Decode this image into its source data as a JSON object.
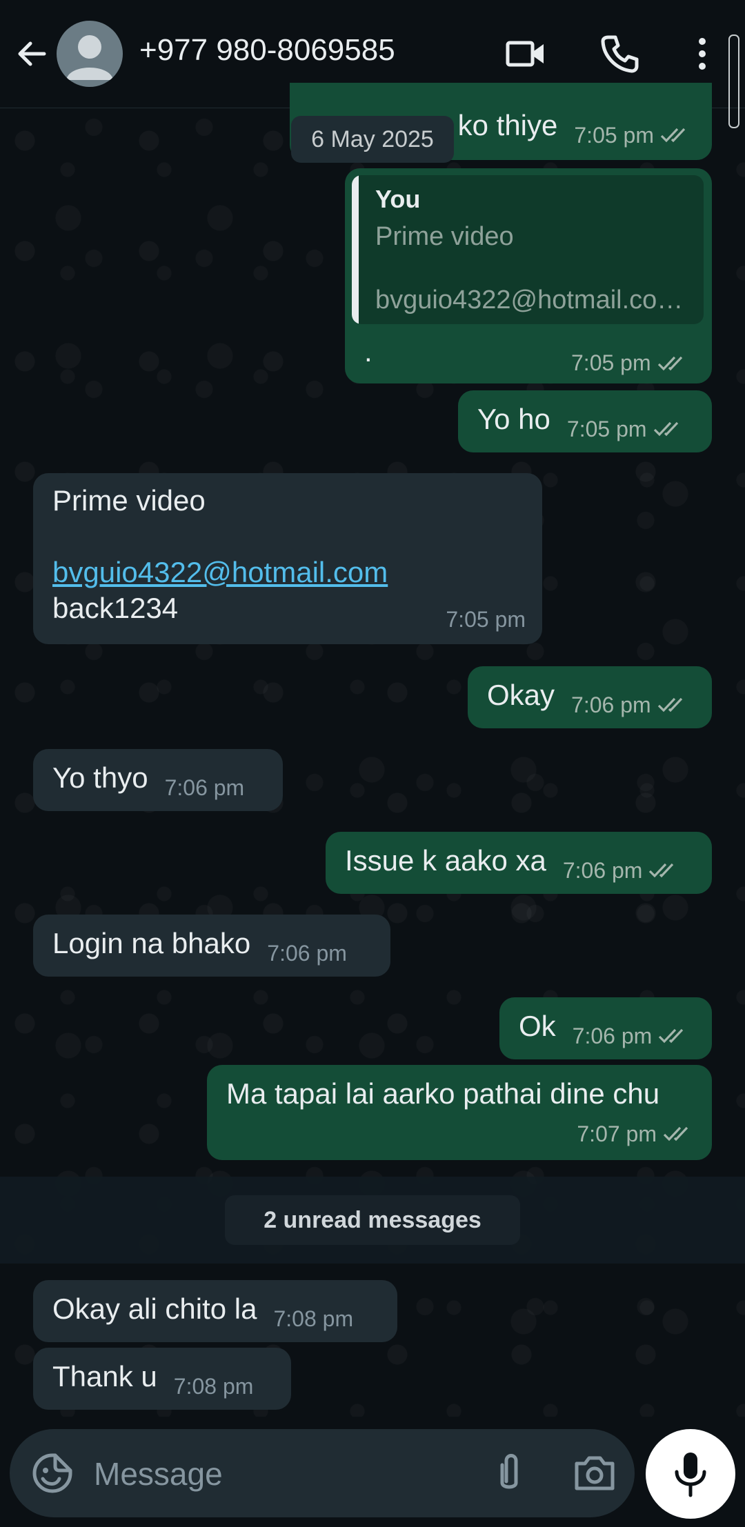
{
  "header": {
    "contact": "+977 980-8069585"
  },
  "date_chip": "6 May 2025",
  "messages": {
    "m0": {
      "text": "ko thiye",
      "time": "7:05 pm"
    },
    "m1": {
      "quote_author": "You",
      "quote_title": "Prime video",
      "quote_email": "bvguio4322@hotmail.co…",
      "text": ".",
      "time": "7:05 pm"
    },
    "m2": {
      "text": "Yo ho",
      "time": "7:05 pm"
    },
    "m3": {
      "line1": "Prime video",
      "email": "bvguio4322@hotmail.com",
      "line3": "back1234",
      "time": "7:05 pm"
    },
    "m4": {
      "text": "Okay",
      "time": "7:06 pm"
    },
    "m5": {
      "text": "Yo thyo",
      "time": "7:06 pm"
    },
    "m6": {
      "text": "Issue k aako xa",
      "time": "7:06 pm"
    },
    "m7": {
      "text": "Login na bhako",
      "time": "7:06 pm"
    },
    "m8": {
      "text": "Ok",
      "time": "7:06 pm"
    },
    "m9": {
      "text": "Ma tapai lai aarko pathai dine chu",
      "time": "7:07 pm"
    },
    "m10": {
      "text": "Okay ali chito la",
      "time": "7:08 pm"
    },
    "m11": {
      "text": "Thank u",
      "time": "7:08 pm"
    }
  },
  "unread_label": "2 unread messages",
  "composer": {
    "placeholder": "Message"
  },
  "colors": {
    "outgoing": "#144d37",
    "incoming": "#202c33",
    "link": "#53bdeb",
    "background": "#0b1014"
  },
  "icons": [
    "back-arrow-icon",
    "avatar-icon",
    "video-call-icon",
    "voice-call-icon",
    "more-options-icon",
    "emoji-icon",
    "attach-icon",
    "camera-icon",
    "mic-icon",
    "double-check-icon"
  ]
}
